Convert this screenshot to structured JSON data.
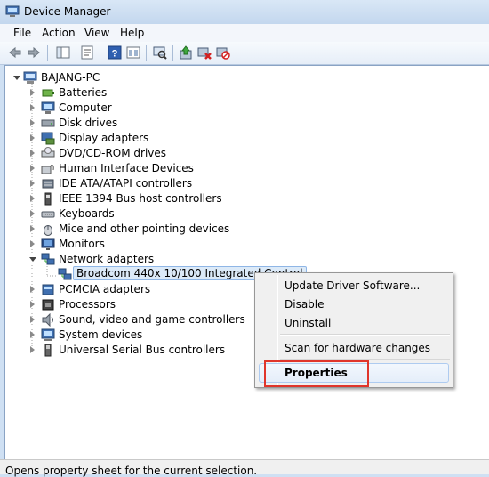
{
  "window": {
    "title": "Device Manager"
  },
  "menu": {
    "file": "File",
    "action": "Action",
    "view": "View",
    "help": "Help"
  },
  "toolbar": {
    "buttons": [
      "back-icon",
      "forward-icon",
      "show-hide-tree-icon",
      "properties-icon",
      "help-icon",
      "show-hidden-icon",
      "scan-icon",
      "update-driver-icon",
      "disable-icon",
      "uninstall-icon"
    ]
  },
  "tree": {
    "root": "BAJANG-PC",
    "items": [
      {
        "label": "Batteries",
        "icon": "battery-icon"
      },
      {
        "label": "Computer",
        "icon": "computer-icon"
      },
      {
        "label": "Disk drives",
        "icon": "disk-drive-icon"
      },
      {
        "label": "Display adapters",
        "icon": "display-adapter-icon"
      },
      {
        "label": "DVD/CD-ROM drives",
        "icon": "dvd-drive-icon"
      },
      {
        "label": "Human Interface Devices",
        "icon": "hid-icon"
      },
      {
        "label": "IDE ATA/ATAPI controllers",
        "icon": "ide-controller-icon"
      },
      {
        "label": "IEEE 1394 Bus host controllers",
        "icon": "ieee1394-icon"
      },
      {
        "label": "Keyboards",
        "icon": "keyboard-icon"
      },
      {
        "label": "Mice and other pointing devices",
        "icon": "mouse-icon"
      },
      {
        "label": "Monitors",
        "icon": "monitor-icon"
      },
      {
        "label": "Network adapters",
        "icon": "network-adapter-icon"
      },
      {
        "label": "Broadcom 440x 10/100 Integrated Control",
        "icon": "network-card-icon"
      },
      {
        "label": "PCMCIA adapters",
        "icon": "pcmcia-icon"
      },
      {
        "label": "Processors",
        "icon": "processor-icon"
      },
      {
        "label": "Sound, video and game controllers",
        "icon": "sound-icon"
      },
      {
        "label": "System devices",
        "icon": "system-devices-icon"
      },
      {
        "label": "Universal Serial Bus controllers",
        "icon": "usb-icon"
      }
    ]
  },
  "context_menu": {
    "update_driver": "Update Driver Software...",
    "disable": "Disable",
    "uninstall": "Uninstall",
    "scan": "Scan for hardware changes",
    "properties": "Properties"
  },
  "status": {
    "text": "Opens property sheet for the current selection."
  }
}
